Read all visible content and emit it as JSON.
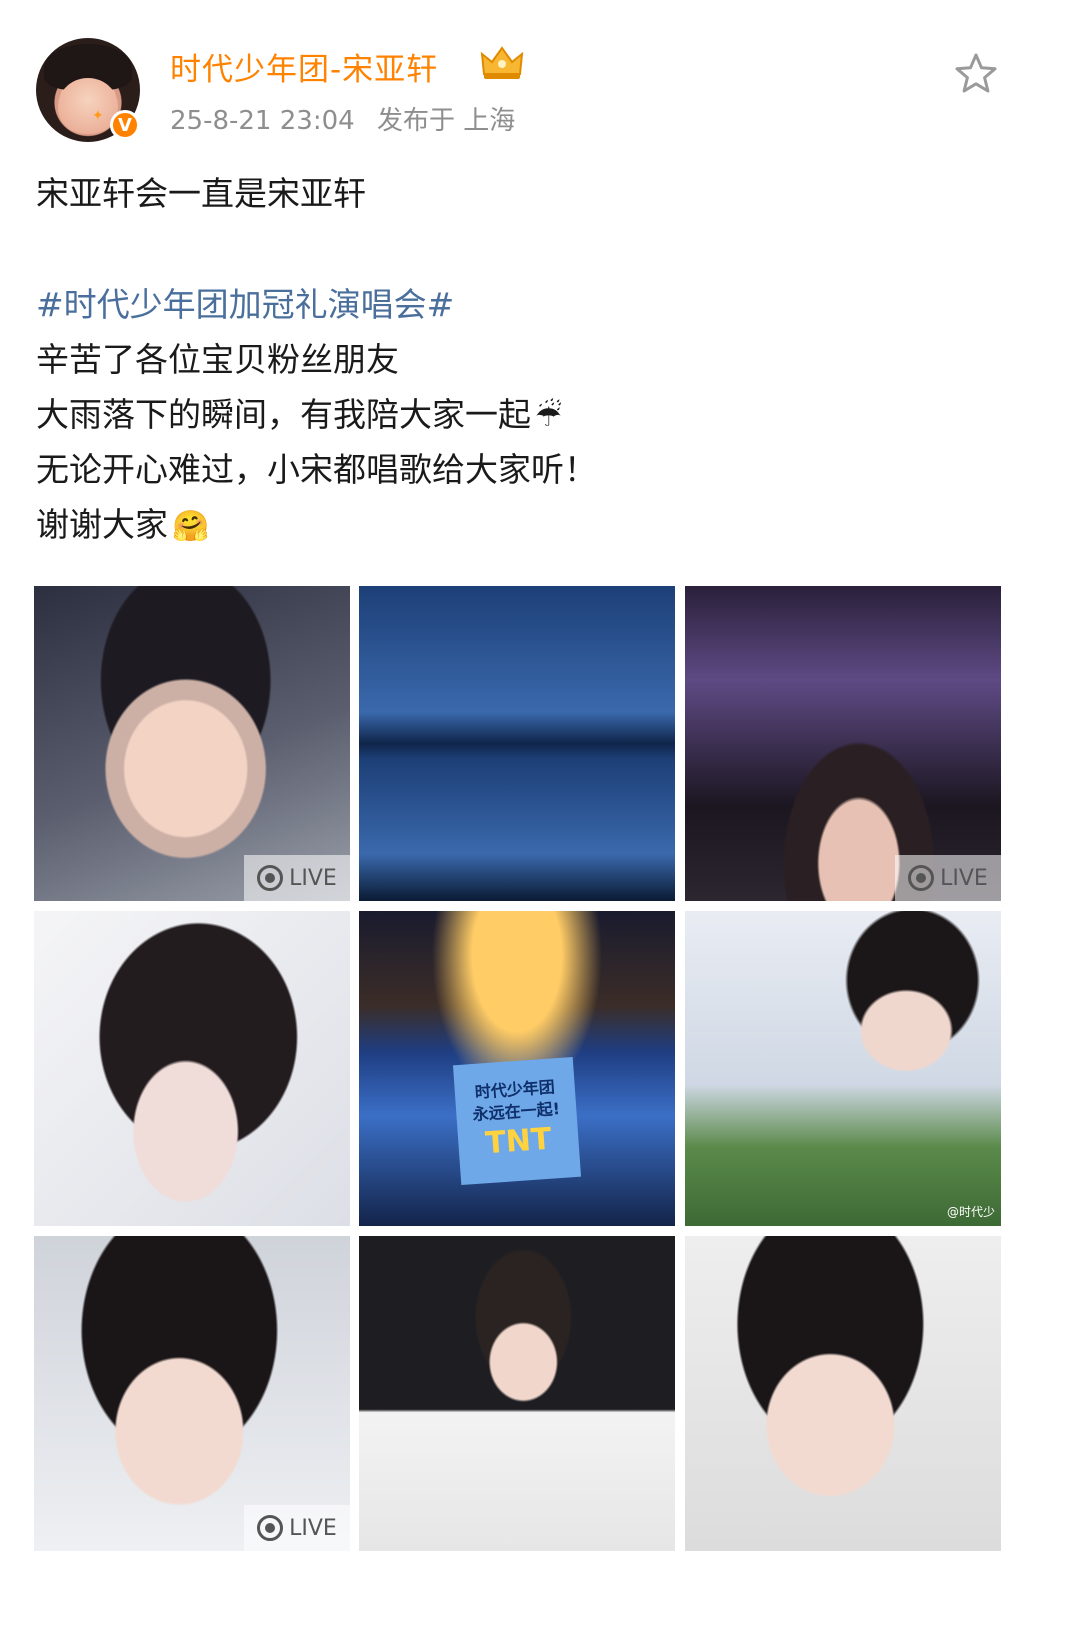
{
  "post": {
    "username": "时代少年团-宋亚轩",
    "timestamp": "25-8-21 23:04",
    "location": "发布于 上海",
    "verified_badge": "V",
    "lines": {
      "l1": "宋亚轩会一直是宋亚轩",
      "hashtag": "#时代少年团加冠礼演唱会#",
      "l2": "辛苦了各位宝贝粉丝朋友",
      "l3": "大雨落下的瞬间，有我陪大家一起",
      "l4": "无论开心难过，小宋都唱歌给大家听！",
      "l5": "谢谢大家"
    },
    "emojis": {
      "umbrella": "☔",
      "hug": "🤗"
    }
  },
  "images": {
    "live_label": "LIVE",
    "watermark": "@时代少",
    "screen_line1": "时代少年团",
    "screen_line2": "永远在一起!",
    "screen_logo": "TNT"
  },
  "icons": {
    "favorite": "star-icon",
    "crown": "crown-icon",
    "live": "live-photo-icon"
  },
  "colors": {
    "username": "#ff8200",
    "hashtag": "#4a6f9d",
    "meta": "#8e8e8e"
  }
}
